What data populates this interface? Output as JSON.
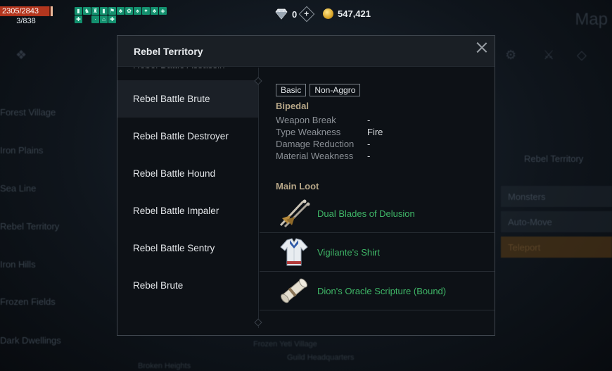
{
  "hud": {
    "hp": "2305/2843",
    "mp": "3/838",
    "buff_glyphs": [
      "▮",
      "♞",
      "♜",
      "▮",
      "⚑",
      "♣",
      "✿",
      "♠",
      "✦",
      "♣",
      "◈",
      "✚",
      "·",
      "⌂",
      "✚"
    ],
    "gems": "0",
    "gold": "547,421"
  },
  "background": {
    "map_title": "Map",
    "left_list": [
      "Forest Village",
      "Iron Plains",
      "Sea Line",
      "Rebel Territory",
      "Iron Hills",
      "Frozen Fields",
      "Dark Dwellings"
    ],
    "right_panel_title": "Rebel Territory",
    "right_rows": [
      "Monsters",
      "Auto-Move",
      "Teleport"
    ],
    "bottom_texts": [
      "Frozen Yeti Village",
      "Guild Headquarters",
      "Broken Heights"
    ]
  },
  "modal": {
    "title": "Rebel Territory",
    "monsters": [
      {
        "name": "Rebel Battle Assassin"
      },
      {
        "name": "Rebel Battle Brute"
      },
      {
        "name": "Rebel Battle Destroyer"
      },
      {
        "name": "Rebel Battle Hound"
      },
      {
        "name": "Rebel Battle Impaler"
      },
      {
        "name": "Rebel Battle Sentry"
      },
      {
        "name": "Rebel Brute"
      }
    ],
    "selected_index": 1,
    "detail": {
      "tags": [
        "Basic",
        "Non-Aggro"
      ],
      "category": "Bipedal",
      "stats": [
        {
          "label": "Weapon Break",
          "value": "-"
        },
        {
          "label": "Type Weakness",
          "value": "Fire"
        },
        {
          "label": "Damage Reduction",
          "value": "-"
        },
        {
          "label": "Material Weakness",
          "value": "-"
        }
      ],
      "loot_title": "Main Loot",
      "loot": [
        {
          "name": "Dual Blades of Delusion",
          "icon": "dual-blades-icon"
        },
        {
          "name": "Vigilante's Shirt",
          "icon": "shirt-icon"
        },
        {
          "name": "Dion's Oracle Scripture (Bound)",
          "icon": "scroll-icon"
        }
      ]
    }
  },
  "colors": {
    "accent_text": "#b7a788",
    "loot_green": "#3fb667",
    "hp_red": "#b3361e",
    "buff_teal": "#13906e"
  }
}
